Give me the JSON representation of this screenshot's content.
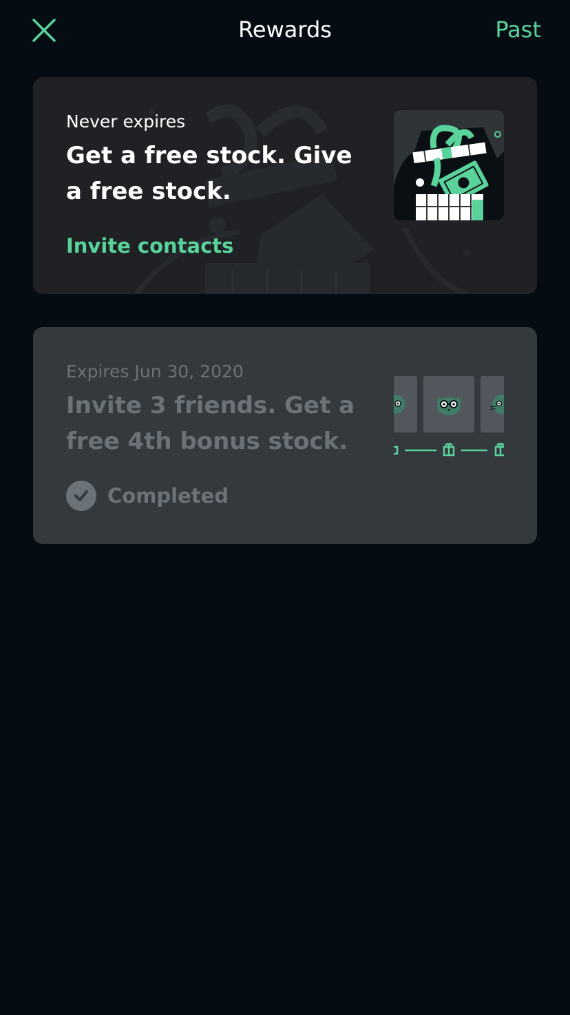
{
  "header": {
    "title": "Rewards",
    "past_label": "Past",
    "close_icon": "close-icon"
  },
  "cards": [
    {
      "eyebrow": "Never expires",
      "headline": "Get a free stock. Give a free stock.",
      "cta_label": "Invite contacts",
      "illustration": "gift-box-with-stock-illustration"
    },
    {
      "eyebrow": "Expires Jun 30, 2020",
      "headline": "Invite 3 friends. Get a free 4th bonus stock.",
      "status_label": "Completed",
      "status_icon": "check-icon",
      "illustration": "friends-cats-gifts-illustration"
    }
  ],
  "colors": {
    "background": "#060c14",
    "accent": "#5ad39a",
    "card_active": "#1f2125",
    "card_completed": "#34393d",
    "muted_text": "#6b7278"
  }
}
